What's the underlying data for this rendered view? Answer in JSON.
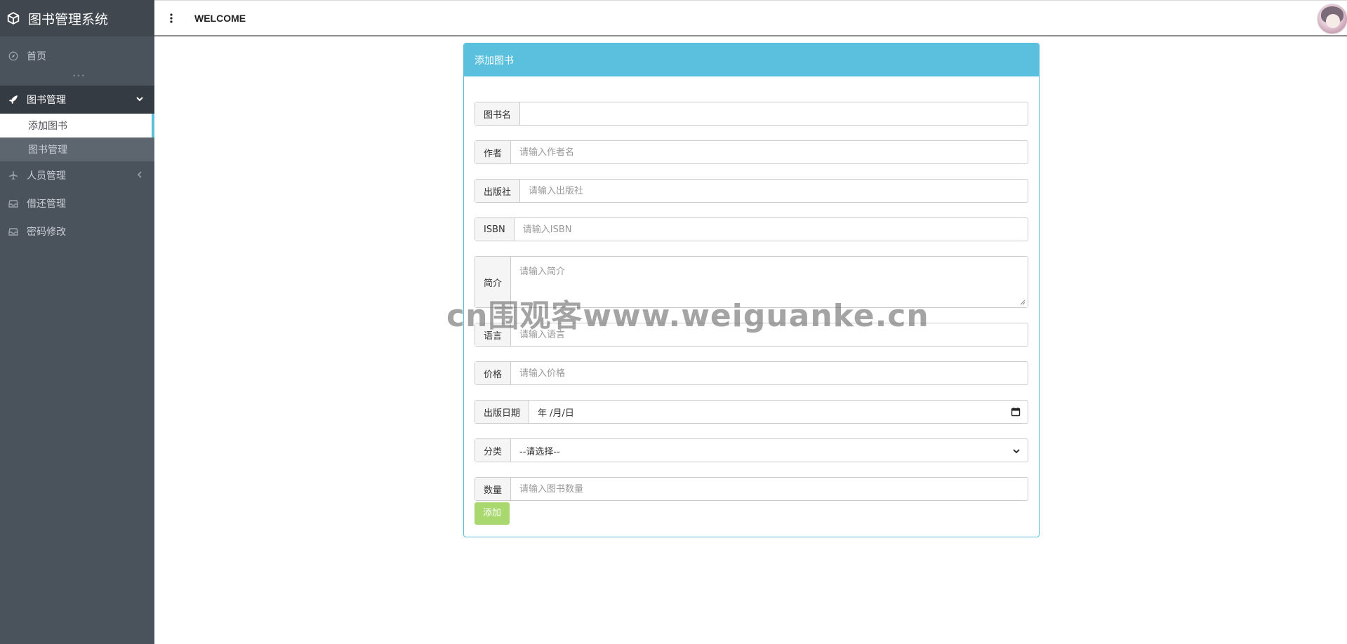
{
  "sidebar": {
    "brand": "图书管理系统",
    "home": "首页",
    "groups": [
      {
        "label": "图书管理",
        "expanded": true,
        "children": [
          {
            "label": "添加图书",
            "current": true
          },
          {
            "label": "图书管理",
            "current": false
          }
        ]
      },
      {
        "label": "人员管理"
      },
      {
        "label": "借还管理"
      },
      {
        "label": "密码修改"
      }
    ]
  },
  "header": {
    "title": "WELCOME"
  },
  "panel": {
    "title": "添加图书",
    "fields": {
      "name": {
        "label": "图书名",
        "value": "",
        "placeholder": ""
      },
      "author": {
        "label": "作者",
        "placeholder": "请输入作者名"
      },
      "publisher": {
        "label": "出版社",
        "placeholder": "请输入出版社"
      },
      "isbn": {
        "label": "ISBN",
        "placeholder": "请输入ISBN"
      },
      "intro": {
        "label": "简介",
        "placeholder": "请输入简介"
      },
      "language": {
        "label": "语言",
        "placeholder": "请输入语言"
      },
      "price": {
        "label": "价格",
        "placeholder": "请输入价格"
      },
      "pubdate": {
        "label": "出版日期",
        "value": "年 /月/日"
      },
      "category": {
        "label": "分类",
        "value": "--请选择--"
      },
      "quantity": {
        "label": "数量",
        "placeholder": "请输入图书数量"
      }
    },
    "submit_label": "添加"
  },
  "watermark": "cn围观客www.weiguanke.cn",
  "colors": {
    "sidebar": "#4a525c",
    "accent": "#5bc0de",
    "submit": "#a9d86e"
  }
}
